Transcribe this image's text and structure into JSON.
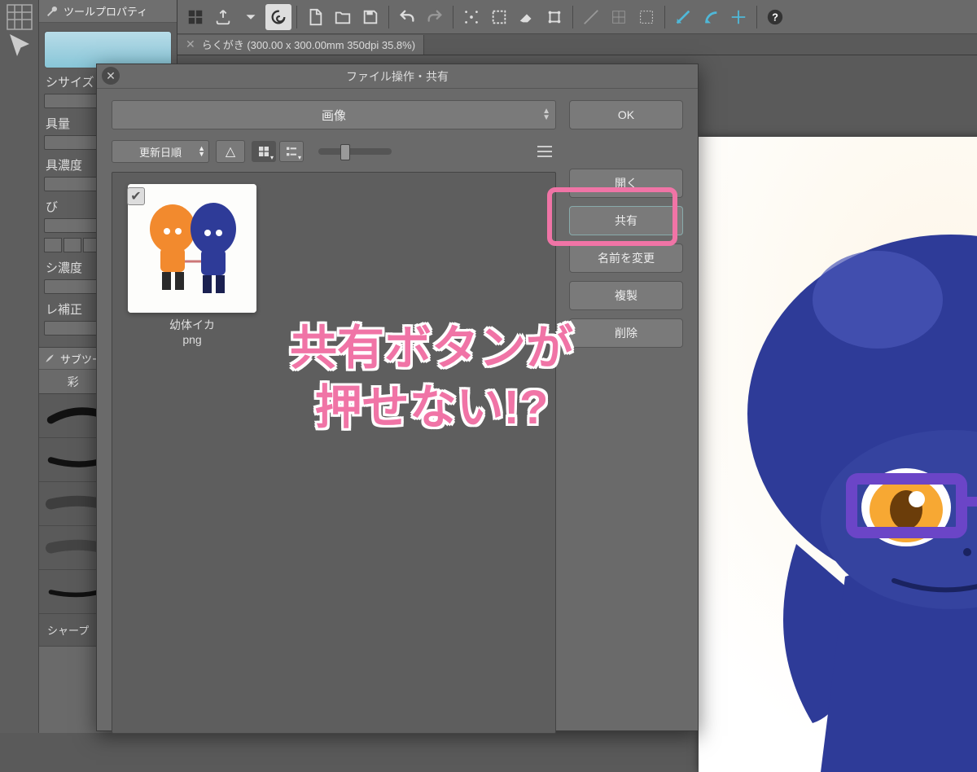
{
  "colors": {
    "accent": "#f074a6",
    "char_body": "#2e3b98",
    "char_eye": "#f7a833",
    "glasses": "#6b45c7"
  },
  "left_panel": {
    "tool_property_title": "ツールプロパティ",
    "rows": [
      {
        "label": "シサイズ"
      },
      {
        "label": "具量"
      },
      {
        "label": "具濃度"
      },
      {
        "label": "び"
      },
      {
        "label": "シ濃度"
      },
      {
        "label": "レ補正"
      }
    ],
    "subtool_title": "サブツール[筆]",
    "subtool_tabs": [
      "彩",
      "油彩"
    ],
    "last_label": "シャープ"
  },
  "document": {
    "tab_title": "らくがき (300.00 x 300.00mm 350dpi 35.8%)"
  },
  "dialog": {
    "title": "ファイル操作・共有",
    "dropdown": "画像",
    "sort": "更新日順",
    "file": {
      "name_line1": "幼体イカ",
      "name_line2": "png"
    },
    "buttons": {
      "ok": "OK",
      "open": "開く",
      "share": "共有",
      "rename": "名前を変更",
      "duplicate": "複製",
      "delete": "削除"
    }
  },
  "annotation": {
    "line1": "共有ボタンが",
    "line2": "押せない!?"
  }
}
